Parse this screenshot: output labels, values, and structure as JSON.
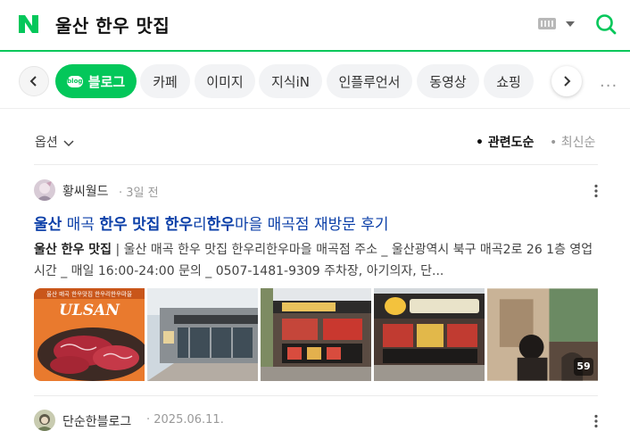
{
  "header": {
    "logo_text": "N",
    "query": "울산 한우 맛집",
    "colors": {
      "brand": "#03c75a",
      "link": "#0b3fa8"
    }
  },
  "tabs": {
    "items": [
      {
        "label": "블로그",
        "badge": "blog",
        "active": true
      },
      {
        "label": "카페"
      },
      {
        "label": "이미지"
      },
      {
        "label": "지식iN"
      },
      {
        "label": "인플루언서"
      },
      {
        "label": "동영상"
      },
      {
        "label": "쇼핑"
      }
    ],
    "more": "···"
  },
  "options": {
    "filter_label": "옵션",
    "sort_relevance": "관련도순",
    "sort_latest": "최신순"
  },
  "posts": [
    {
      "author": "황씨월드",
      "date": "3일 전",
      "title_parts": [
        "울산",
        " 매곡 ",
        "한우",
        " ",
        "맛집",
        " ",
        "한우",
        "리",
        "한우",
        "마을 매곡점 재방문 후기"
      ],
      "desc_bold": "울산 한우 맛집",
      "desc_rest": " | 울산 매곡 한우 맛집 한우리한우마을 매곡점 주소 _ 울산광역시 북구 매곡2로 26 1층 영업시간 _ 매일 16:00-24:00 문의 _ 0507-1481-9309 주차장, 아기의자, 단...",
      "image_count": "59",
      "thumb1_caption": "울산 매곡 한우맛집 한우리한우마을",
      "thumb1_text": "ULSAN"
    },
    {
      "author": "단순한블로그",
      "date": "2025.06.11."
    }
  ]
}
